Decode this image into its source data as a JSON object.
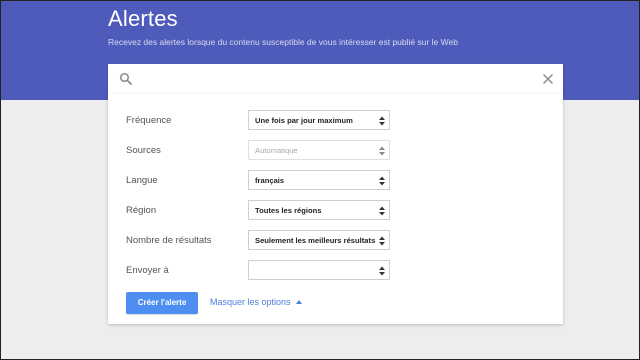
{
  "header": {
    "title": "Alertes",
    "subtitle": "Recevez des alertes lorsque du contenu susceptible de vous intéresser est publié sur le Web"
  },
  "search": {
    "value": "",
    "placeholder": "",
    "icon": "search-icon",
    "clear_icon": "close-icon"
  },
  "options": [
    {
      "label": "Fréquence",
      "value": "Une fois par jour maximum",
      "disabled": false
    },
    {
      "label": "Sources",
      "value": "Automatique",
      "disabled": true
    },
    {
      "label": "Langue",
      "value": "français",
      "disabled": false
    },
    {
      "label": "Région",
      "value": "Toutes les régions",
      "disabled": false
    },
    {
      "label": "Nombre de résultats",
      "value": "Seulement les meilleurs résultats",
      "disabled": false
    },
    {
      "label": "Envoyer à",
      "value": "",
      "disabled": false
    }
  ],
  "actions": {
    "create_label": "Créer l'alerte",
    "toggle_options_label": "Masquer les options"
  },
  "colors": {
    "header_bg": "#4f5bbb",
    "primary_button": "#4d8ef0",
    "link": "#4d7fe0",
    "page_bg": "#ededed"
  }
}
